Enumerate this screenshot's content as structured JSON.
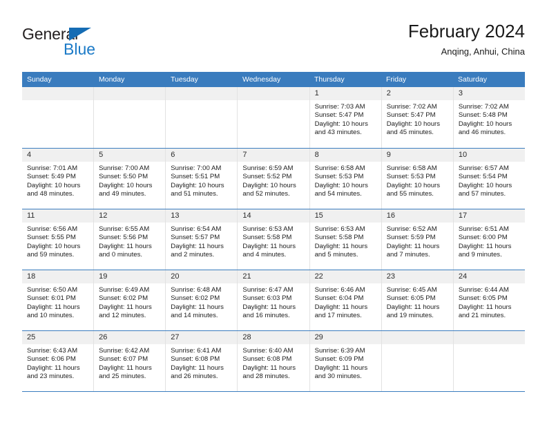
{
  "brand": {
    "name_part1": "General",
    "name_part2": "Blue",
    "triangle_icon": "triangle-icon",
    "color_dark": "#231f20",
    "color_blue": "#1b7ac7"
  },
  "header": {
    "title": "February 2024",
    "subtitle": "Anqing, Anhui, China"
  },
  "theme": {
    "header_bar": "#3a7cbe",
    "daynum_band": "#f0f0f0",
    "row_divider": "#3a7cbe",
    "cell_divider": "#e2e2e2"
  },
  "weekdays": [
    "Sunday",
    "Monday",
    "Tuesday",
    "Wednesday",
    "Thursday",
    "Friday",
    "Saturday"
  ],
  "labels": {
    "sunrise_prefix": "Sunrise:",
    "sunset_prefix": "Sunset:",
    "daylight_prefix": "Daylight:"
  },
  "weeks": [
    [
      {
        "day": "",
        "empty": true,
        "line1": "",
        "line2": "",
        "line3": "",
        "line4": ""
      },
      {
        "day": "",
        "empty": true,
        "line1": "",
        "line2": "",
        "line3": "",
        "line4": ""
      },
      {
        "day": "",
        "empty": true,
        "line1": "",
        "line2": "",
        "line3": "",
        "line4": ""
      },
      {
        "day": "",
        "empty": true,
        "line1": "",
        "line2": "",
        "line3": "",
        "line4": ""
      },
      {
        "day": "1",
        "empty": false,
        "line1": "Sunrise: 7:03 AM",
        "line2": "Sunset: 5:47 PM",
        "line3": "Daylight: 10 hours",
        "line4": "and 43 minutes."
      },
      {
        "day": "2",
        "empty": false,
        "line1": "Sunrise: 7:02 AM",
        "line2": "Sunset: 5:47 PM",
        "line3": "Daylight: 10 hours",
        "line4": "and 45 minutes."
      },
      {
        "day": "3",
        "empty": false,
        "line1": "Sunrise: 7:02 AM",
        "line2": "Sunset: 5:48 PM",
        "line3": "Daylight: 10 hours",
        "line4": "and 46 minutes."
      }
    ],
    [
      {
        "day": "4",
        "empty": false,
        "line1": "Sunrise: 7:01 AM",
        "line2": "Sunset: 5:49 PM",
        "line3": "Daylight: 10 hours",
        "line4": "and 48 minutes."
      },
      {
        "day": "5",
        "empty": false,
        "line1": "Sunrise: 7:00 AM",
        "line2": "Sunset: 5:50 PM",
        "line3": "Daylight: 10 hours",
        "line4": "and 49 minutes."
      },
      {
        "day": "6",
        "empty": false,
        "line1": "Sunrise: 7:00 AM",
        "line2": "Sunset: 5:51 PM",
        "line3": "Daylight: 10 hours",
        "line4": "and 51 minutes."
      },
      {
        "day": "7",
        "empty": false,
        "line1": "Sunrise: 6:59 AM",
        "line2": "Sunset: 5:52 PM",
        "line3": "Daylight: 10 hours",
        "line4": "and 52 minutes."
      },
      {
        "day": "8",
        "empty": false,
        "line1": "Sunrise: 6:58 AM",
        "line2": "Sunset: 5:53 PM",
        "line3": "Daylight: 10 hours",
        "line4": "and 54 minutes."
      },
      {
        "day": "9",
        "empty": false,
        "line1": "Sunrise: 6:58 AM",
        "line2": "Sunset: 5:53 PM",
        "line3": "Daylight: 10 hours",
        "line4": "and 55 minutes."
      },
      {
        "day": "10",
        "empty": false,
        "line1": "Sunrise: 6:57 AM",
        "line2": "Sunset: 5:54 PM",
        "line3": "Daylight: 10 hours",
        "line4": "and 57 minutes."
      }
    ],
    [
      {
        "day": "11",
        "empty": false,
        "line1": "Sunrise: 6:56 AM",
        "line2": "Sunset: 5:55 PM",
        "line3": "Daylight: 10 hours",
        "line4": "and 59 minutes."
      },
      {
        "day": "12",
        "empty": false,
        "line1": "Sunrise: 6:55 AM",
        "line2": "Sunset: 5:56 PM",
        "line3": "Daylight: 11 hours",
        "line4": "and 0 minutes."
      },
      {
        "day": "13",
        "empty": false,
        "line1": "Sunrise: 6:54 AM",
        "line2": "Sunset: 5:57 PM",
        "line3": "Daylight: 11 hours",
        "line4": "and 2 minutes."
      },
      {
        "day": "14",
        "empty": false,
        "line1": "Sunrise: 6:53 AM",
        "line2": "Sunset: 5:58 PM",
        "line3": "Daylight: 11 hours",
        "line4": "and 4 minutes."
      },
      {
        "day": "15",
        "empty": false,
        "line1": "Sunrise: 6:53 AM",
        "line2": "Sunset: 5:58 PM",
        "line3": "Daylight: 11 hours",
        "line4": "and 5 minutes."
      },
      {
        "day": "16",
        "empty": false,
        "line1": "Sunrise: 6:52 AM",
        "line2": "Sunset: 5:59 PM",
        "line3": "Daylight: 11 hours",
        "line4": "and 7 minutes."
      },
      {
        "day": "17",
        "empty": false,
        "line1": "Sunrise: 6:51 AM",
        "line2": "Sunset: 6:00 PM",
        "line3": "Daylight: 11 hours",
        "line4": "and 9 minutes."
      }
    ],
    [
      {
        "day": "18",
        "empty": false,
        "line1": "Sunrise: 6:50 AM",
        "line2": "Sunset: 6:01 PM",
        "line3": "Daylight: 11 hours",
        "line4": "and 10 minutes."
      },
      {
        "day": "19",
        "empty": false,
        "line1": "Sunrise: 6:49 AM",
        "line2": "Sunset: 6:02 PM",
        "line3": "Daylight: 11 hours",
        "line4": "and 12 minutes."
      },
      {
        "day": "20",
        "empty": false,
        "line1": "Sunrise: 6:48 AM",
        "line2": "Sunset: 6:02 PM",
        "line3": "Daylight: 11 hours",
        "line4": "and 14 minutes."
      },
      {
        "day": "21",
        "empty": false,
        "line1": "Sunrise: 6:47 AM",
        "line2": "Sunset: 6:03 PM",
        "line3": "Daylight: 11 hours",
        "line4": "and 16 minutes."
      },
      {
        "day": "22",
        "empty": false,
        "line1": "Sunrise: 6:46 AM",
        "line2": "Sunset: 6:04 PM",
        "line3": "Daylight: 11 hours",
        "line4": "and 17 minutes."
      },
      {
        "day": "23",
        "empty": false,
        "line1": "Sunrise: 6:45 AM",
        "line2": "Sunset: 6:05 PM",
        "line3": "Daylight: 11 hours",
        "line4": "and 19 minutes."
      },
      {
        "day": "24",
        "empty": false,
        "line1": "Sunrise: 6:44 AM",
        "line2": "Sunset: 6:05 PM",
        "line3": "Daylight: 11 hours",
        "line4": "and 21 minutes."
      }
    ],
    [
      {
        "day": "25",
        "empty": false,
        "line1": "Sunrise: 6:43 AM",
        "line2": "Sunset: 6:06 PM",
        "line3": "Daylight: 11 hours",
        "line4": "and 23 minutes."
      },
      {
        "day": "26",
        "empty": false,
        "line1": "Sunrise: 6:42 AM",
        "line2": "Sunset: 6:07 PM",
        "line3": "Daylight: 11 hours",
        "line4": "and 25 minutes."
      },
      {
        "day": "27",
        "empty": false,
        "line1": "Sunrise: 6:41 AM",
        "line2": "Sunset: 6:08 PM",
        "line3": "Daylight: 11 hours",
        "line4": "and 26 minutes."
      },
      {
        "day": "28",
        "empty": false,
        "line1": "Sunrise: 6:40 AM",
        "line2": "Sunset: 6:08 PM",
        "line3": "Daylight: 11 hours",
        "line4": "and 28 minutes."
      },
      {
        "day": "29",
        "empty": false,
        "line1": "Sunrise: 6:39 AM",
        "line2": "Sunset: 6:09 PM",
        "line3": "Daylight: 11 hours",
        "line4": "and 30 minutes."
      },
      {
        "day": "",
        "empty": true,
        "line1": "",
        "line2": "",
        "line3": "",
        "line4": ""
      },
      {
        "day": "",
        "empty": true,
        "line1": "",
        "line2": "",
        "line3": "",
        "line4": ""
      }
    ]
  ]
}
